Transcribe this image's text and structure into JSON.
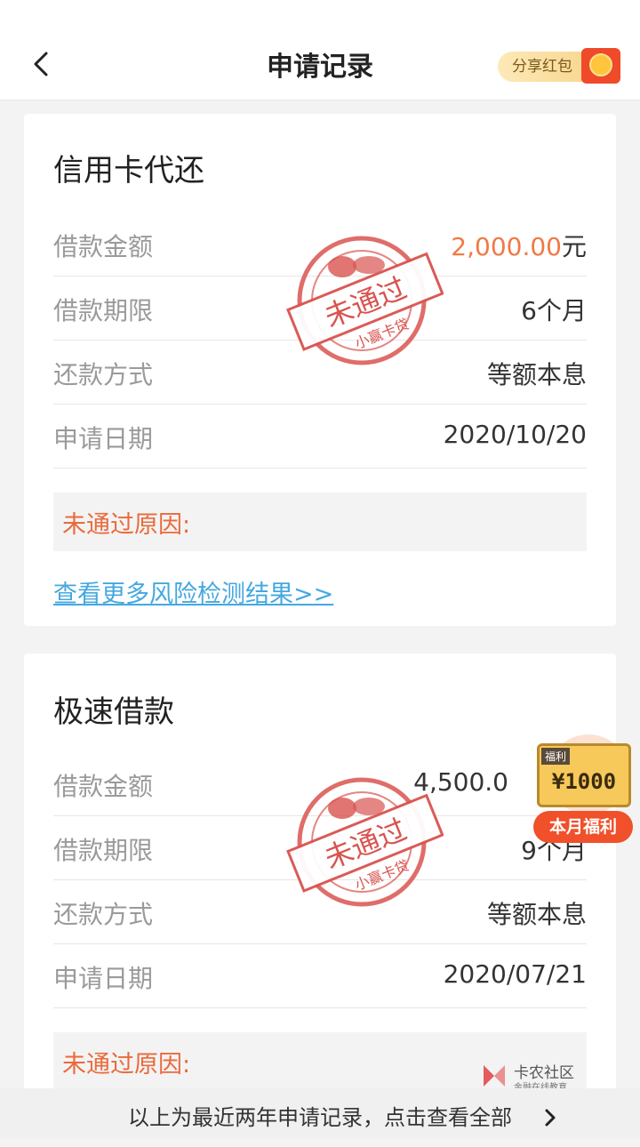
{
  "header": {
    "title": "申请记录",
    "share_label": "分享红包"
  },
  "cards": [
    {
      "title": "信用卡代还",
      "rows": [
        {
          "label": "借款金额",
          "value": "2,000.00",
          "unit": "元"
        },
        {
          "label": "借款期限",
          "value": "6个月"
        },
        {
          "label": "还款方式",
          "value": "等额本息"
        },
        {
          "label": "申请日期",
          "value": "2020/10/20"
        }
      ],
      "reason_label": "未通过原因:",
      "link": "查看更多风险检测结果>>",
      "stamp": {
        "main": "未通过",
        "sub": "小赢卡贷"
      }
    },
    {
      "title": "极速借款",
      "rows": [
        {
          "label": "借款金额",
          "value": "4,500.0"
        },
        {
          "label": "借款期限",
          "value": "9个月"
        },
        {
          "label": "还款方式",
          "value": "等额本息"
        },
        {
          "label": "申请日期",
          "value": "2020/07/21"
        }
      ],
      "reason_label": "未通过原因:",
      "stamp": {
        "main": "未通过",
        "sub": "小赢卡贷"
      }
    }
  ],
  "bonus": {
    "tag": "福利",
    "amount": "¥1000",
    "button": "本月福利"
  },
  "footer": {
    "text": "以上为最近两年申请记录，点击查看全部"
  },
  "watermark": {
    "name": "卡农社区",
    "sub": "金融在线教育"
  },
  "colors": {
    "accent": "#ef7a45",
    "reason": "#ea6a3a",
    "link": "#45a8e0",
    "stamp": "#d9534f"
  }
}
